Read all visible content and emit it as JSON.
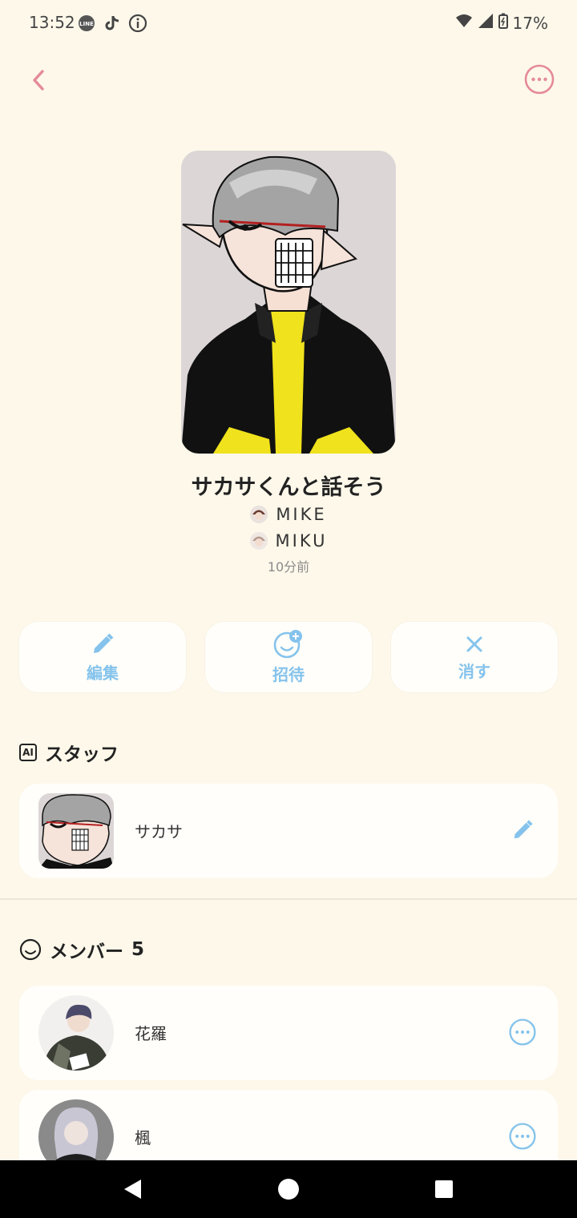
{
  "status_bar": {
    "time": "13:52",
    "battery": "17%",
    "line_icon": "LINE"
  },
  "room": {
    "title": "サカサくんと話そう",
    "owners": [
      "MIKE",
      "MIKU"
    ],
    "updated": "10分前"
  },
  "actions": {
    "edit": "編集",
    "invite": "招待",
    "delete": "消す"
  },
  "staff": {
    "badge": "AI",
    "heading": "スタッフ",
    "items": [
      {
        "name": "サカサ"
      }
    ]
  },
  "members": {
    "heading": "メンバー",
    "count": "5",
    "items": [
      {
        "name": "花羅"
      },
      {
        "name": "楓"
      }
    ]
  },
  "colors": {
    "accent_pink": "#e58a97",
    "accent_blue": "#85c3ec",
    "background": "#fdf8ea",
    "card": "#fffefa"
  },
  "icons": {
    "back": "chevron-left-icon",
    "more": "more-horizontal-icon",
    "edit": "pencil-icon",
    "invite": "smiley-plus-icon",
    "delete": "close-icon",
    "member_more": "more-horizontal-icon"
  }
}
